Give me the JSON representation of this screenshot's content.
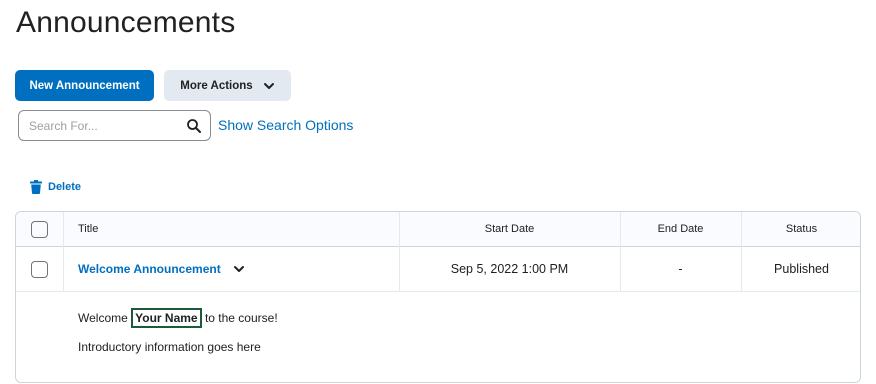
{
  "page": {
    "title": "Announcements"
  },
  "toolbar": {
    "new_announcement": "New Announcement",
    "more_actions": "More Actions"
  },
  "search": {
    "placeholder": "Search For...",
    "value": "",
    "options_link": "Show Search Options"
  },
  "actions": {
    "delete": "Delete"
  },
  "table": {
    "columns": [
      "Title",
      "Start Date",
      "End Date",
      "Status"
    ],
    "rows": [
      {
        "title": "Welcome Announcement",
        "start_date": "Sep 5, 2022 1:00 PM",
        "end_date": "-",
        "status": "Published",
        "body": {
          "welcome_prefix": "Welcome ",
          "highlighted_name": "Your Name",
          "welcome_suffix": " to the course!",
          "intro": "Introductory information goes here"
        }
      }
    ]
  },
  "colors": {
    "accent": "#006fbf",
    "secondary_button": "#e3e9f1",
    "name_highlight_border": "#1c5b3a",
    "table_border": "#cdd5dc"
  },
  "icons": {
    "more_actions": "chevron-down-icon",
    "search": "search-icon",
    "delete": "trash-icon",
    "row_menu": "chevron-down-icon"
  }
}
